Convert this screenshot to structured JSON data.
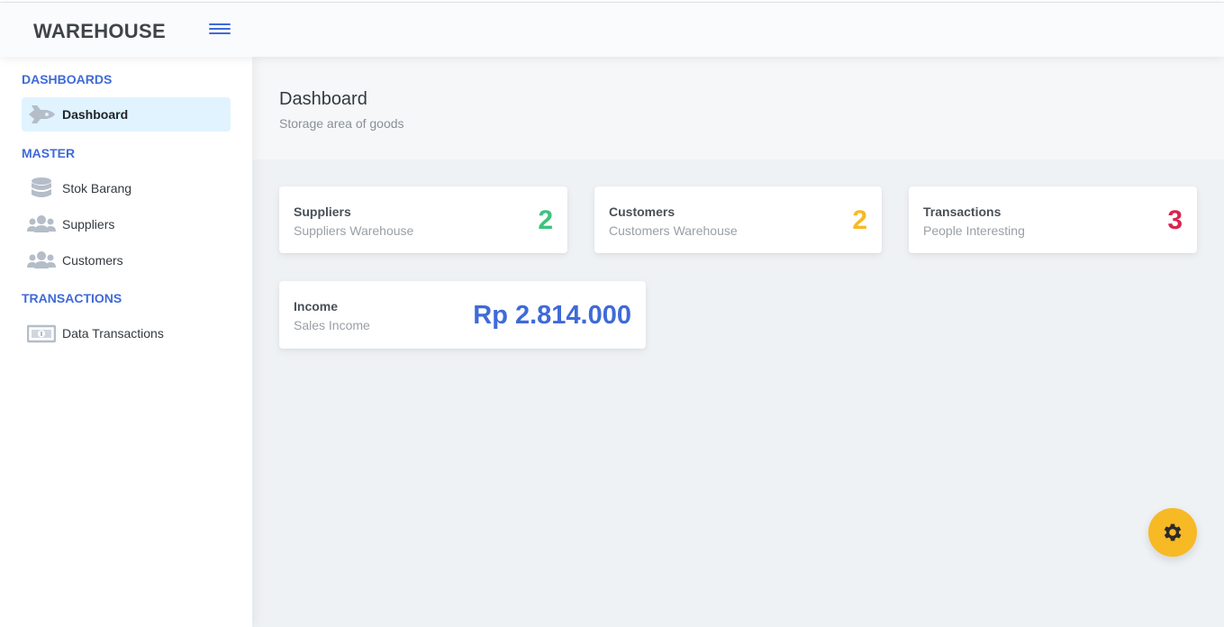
{
  "header": {
    "brand": "WAREHOUSE",
    "accent_color": "#3f6ad8"
  },
  "sidebar": {
    "sections": [
      {
        "heading": "DASHBOARDS"
      },
      {
        "heading": "MASTER"
      },
      {
        "heading": "TRANSACTIONS"
      }
    ],
    "items": [
      {
        "label": "Dashboard",
        "icon": "rocket-icon",
        "active": true
      },
      {
        "label": "Stok Barang",
        "icon": "database-icon",
        "active": false
      },
      {
        "label": "Suppliers",
        "icon": "users-icon",
        "active": false
      },
      {
        "label": "Customers",
        "icon": "users-icon",
        "active": false
      },
      {
        "label": "Data Transactions",
        "icon": "money-bill-icon",
        "active": false
      }
    ]
  },
  "page": {
    "title": "Dashboard",
    "subtitle": "Storage area of goods"
  },
  "cards": [
    {
      "title": "Suppliers",
      "subtitle": "Suppliers Warehouse",
      "value": "2",
      "color": "#3ac47d"
    },
    {
      "title": "Customers",
      "subtitle": "Customers Warehouse",
      "value": "2",
      "color": "#f7b924"
    },
    {
      "title": "Transactions",
      "subtitle": "People Interesting",
      "value": "3",
      "color": "#d92550"
    },
    {
      "title": "Income",
      "subtitle": "Sales Income",
      "value": "Rp 2.814.000",
      "color": "#3f6ad8"
    }
  ],
  "fab": {
    "icon": "gear-icon",
    "color": "#f7b924"
  }
}
